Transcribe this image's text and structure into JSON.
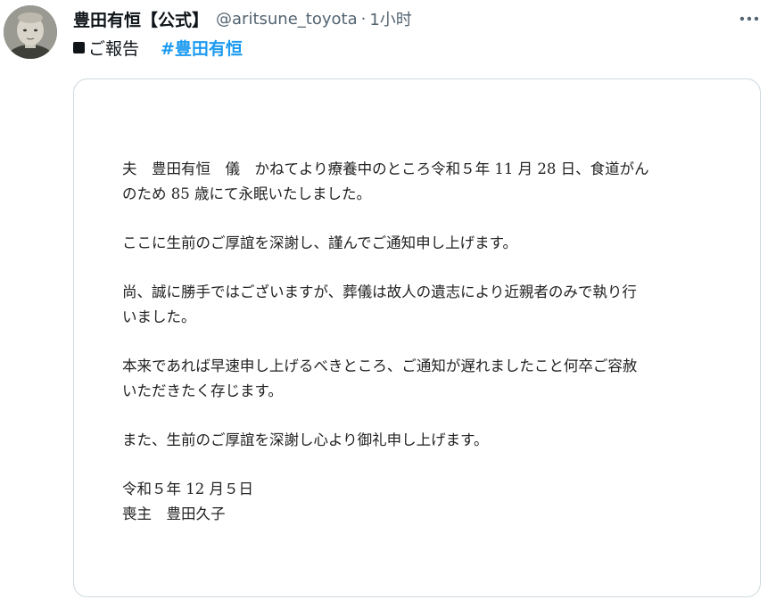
{
  "tweet": {
    "avatar_alt": "avatar",
    "display_name": "豊田有恒【公式】",
    "handle": "@aritsune_toyota",
    "separator": "·",
    "time": "1小时",
    "more_icon": "more-horizontal-icon",
    "text_prefix": "ご報告",
    "hashtag": "#豊田有恒"
  },
  "letter": {
    "paragraph1": [
      "夫　豊田有恒　儀　かねてより療養中のところ令和５年 11 月 28 日、食道がん",
      "のため 85 歳にて永眠いたしました。"
    ],
    "paragraph2": [
      "ここに生前のご厚誼を深謝し、謹んでご通知申し上げます。"
    ],
    "paragraph3": [
      "尚、誠に勝手ではございますが、葬儀は故人の遺志により近親者のみで執り行",
      "いました。"
    ],
    "paragraph4": [
      "本来であれば早速申し上げるべきところ、ご通知が遅れましたこと何卒ご容赦",
      "いただきたく存じます。"
    ],
    "paragraph5": [
      "また、生前のご厚誼を深謝し心より御礼申し上げます。"
    ],
    "date": "令和５年 12 月５日",
    "signature": "喪主　豊田久子"
  },
  "colors": {
    "text": "#0f1419",
    "secondary": "#536471",
    "accent": "#1d9bf0",
    "border": "#cfd9de"
  }
}
